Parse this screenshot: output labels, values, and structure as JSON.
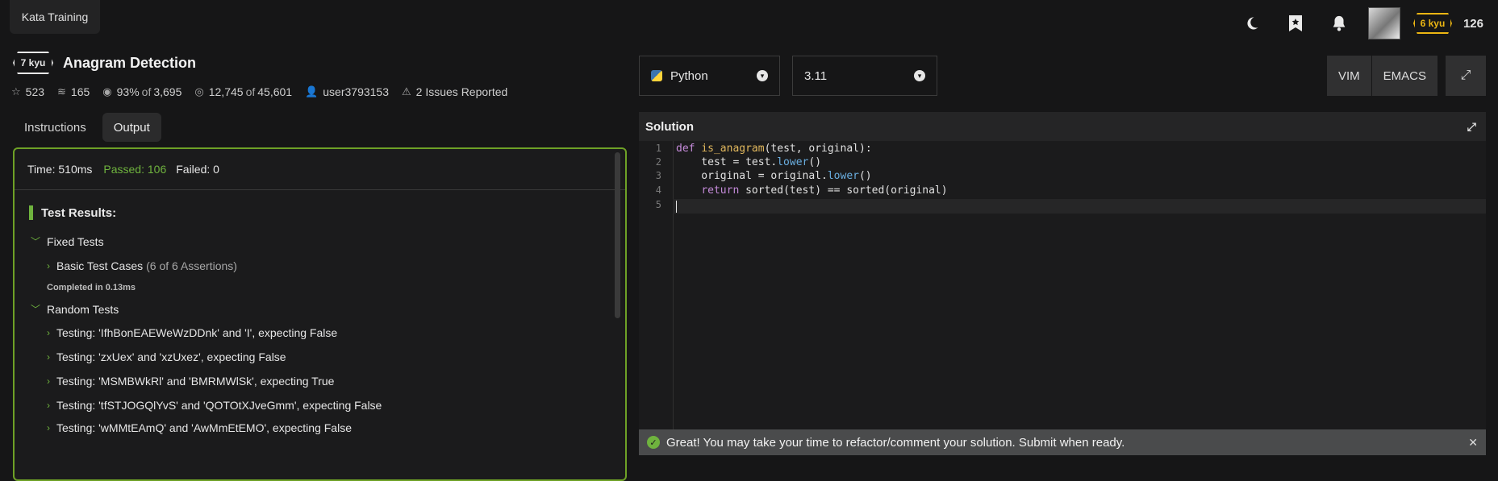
{
  "top": {
    "tab_label": "Kata Training",
    "kyu": "6 kyu",
    "honor": "126"
  },
  "kata": {
    "rank": "7 kyu",
    "title": "Anagram Detection",
    "stats": {
      "stars": "523",
      "collections": "165",
      "satisfaction": "93%",
      "of": "of",
      "votes": "3,695",
      "completed": "12,745",
      "attempted": "45,601",
      "author": "user3793153",
      "issues": "2 Issues Reported"
    }
  },
  "tabs": [
    {
      "label": "Instructions",
      "active": false
    },
    {
      "label": "Output",
      "active": true
    }
  ],
  "output": {
    "time": "Time: 510ms",
    "passed": "Passed: 106",
    "failed": "Failed: 0",
    "results_title": "Test Results:",
    "fixed_group": "Fixed Tests",
    "basic_case": "Basic Test Cases",
    "basic_assertions": "(6 of 6 Assertions)",
    "completed_in": "Completed in 0.13ms",
    "random_group": "Random Tests",
    "random_tests": [
      "Testing: 'IfhBonEAEWeWzDDnk' and 'I', expecting False",
      "Testing: 'zxUex' and 'xzUxez', expecting False",
      "Testing: 'MSMBWkRl' and 'BMRMWlSk', expecting True",
      "Testing: 'tfSTJOGQlYvS' and 'QOTOtXJveGmm', expecting False",
      "Testing: 'wMMtEAmQ' and 'AwMmEtEMO', expecting False"
    ]
  },
  "editor": {
    "language": "Python",
    "version": "3.11",
    "vim": "VIM",
    "emacs": "EMACS",
    "title": "Solution",
    "line_numbers": [
      "1",
      "2",
      "3",
      "4",
      "5"
    ]
  },
  "toast": {
    "message": "Great! You may take your time to refactor/comment your solution. Submit when ready."
  },
  "colors": {
    "accent_green": "#6fb33e",
    "border_green": "#6ea126",
    "kyu_yellow": "#ecb613"
  }
}
